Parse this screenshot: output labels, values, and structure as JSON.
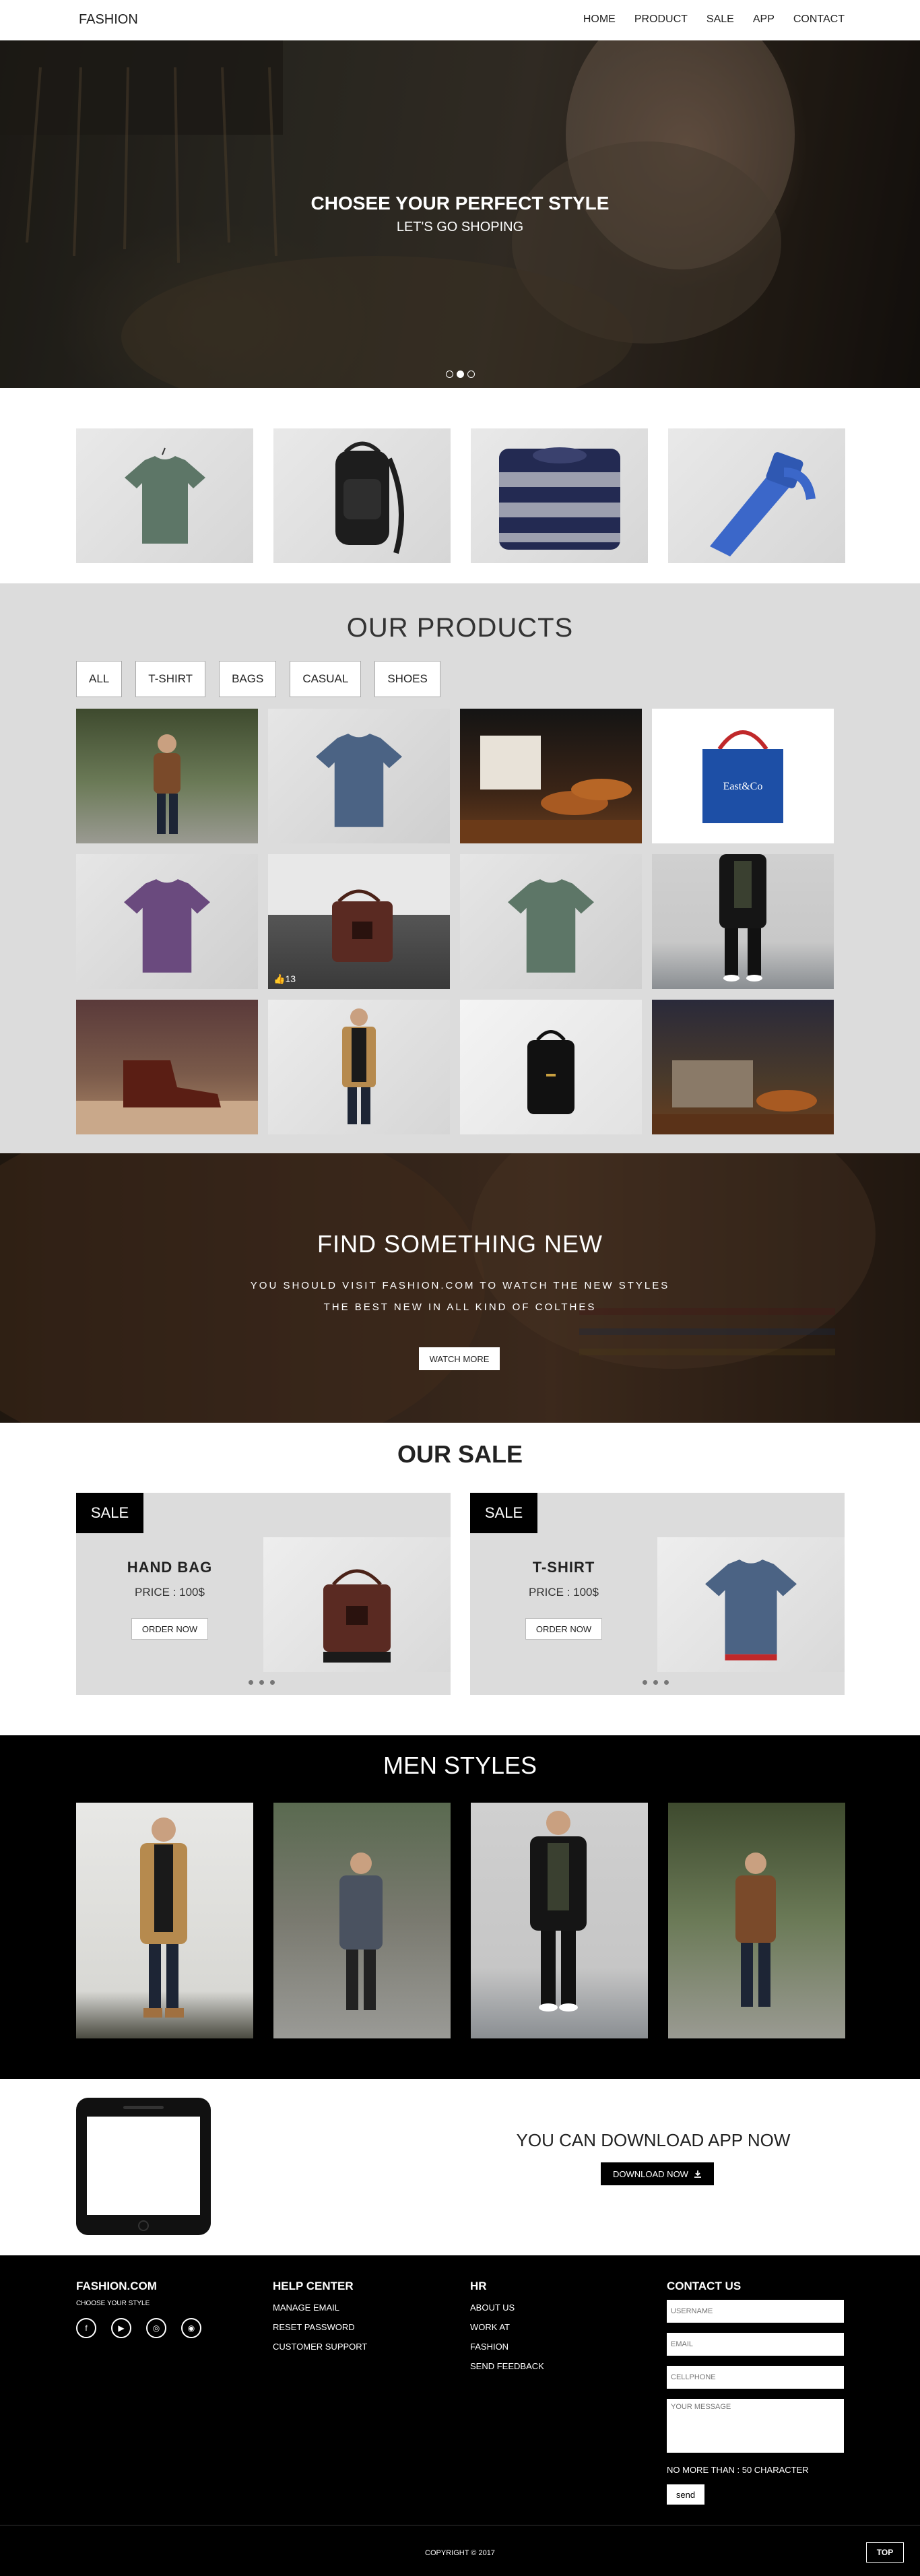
{
  "nav": {
    "brand": "FASHION",
    "items": [
      "HOME",
      "PRODUCT",
      "SALE",
      "APP",
      "CONTACT"
    ]
  },
  "hero": {
    "title": "CHOSEE YOUR PERFECT STYLE",
    "subtitle": "LET'S GO SHOPING",
    "slides": 3,
    "active_slide": 2
  },
  "products": {
    "title": "OUR PRODUCTS",
    "filters": [
      "ALL",
      "T-SHIRT",
      "BAGS",
      "CASUAL",
      "SHOES"
    ],
    "like_count": "13"
  },
  "banner": {
    "title": "FIND SOMETHING NEW",
    "line1": "YOU SHOULD VISIT FASHION.COM TO WATCH THE NEW STYLES",
    "line2": "THE BEST NEW IN ALL KIND OF COLTHES",
    "button": "WATCH MORE"
  },
  "sale": {
    "title": "OUR SALE",
    "cards": [
      {
        "tag": "SALE",
        "name": "HAND BAG",
        "price": "PRICE : 100$",
        "button": "ORDER NOW"
      },
      {
        "tag": "SALE",
        "name": "T-SHIRT",
        "price": "PRICE : 100$",
        "button": "ORDER NOW"
      }
    ]
  },
  "men": {
    "title": "MEN STYLES"
  },
  "app": {
    "title": "YOU CAN DOWNLOAD APP NOW",
    "button": "DOWNLOAD NOW"
  },
  "footer": {
    "brand": "FASHION.COM",
    "tagline": "CHOOSE YOUR STYLE",
    "help_title": "HELP CENTER",
    "help_links": [
      "MANAGE EMAIL",
      "RESET PASSWORD",
      "CUSTOMER SUPPORT"
    ],
    "hr_title": "HR",
    "hr_links": [
      "ABOUT US",
      "WORK AT",
      "FASHION",
      "SEND FEEDBACK"
    ],
    "contact_title": "CONTACT US",
    "placeholders": {
      "username": "USERNAME",
      "email": "EMAIL",
      "cellphone": "CELLPHONE",
      "message": "YOUR MESSAGE"
    },
    "note": "NO MORE THAN : 50 CHARACTER",
    "send": "send",
    "copyright": "COPYRIGHT © 2017",
    "top": "TOP"
  }
}
